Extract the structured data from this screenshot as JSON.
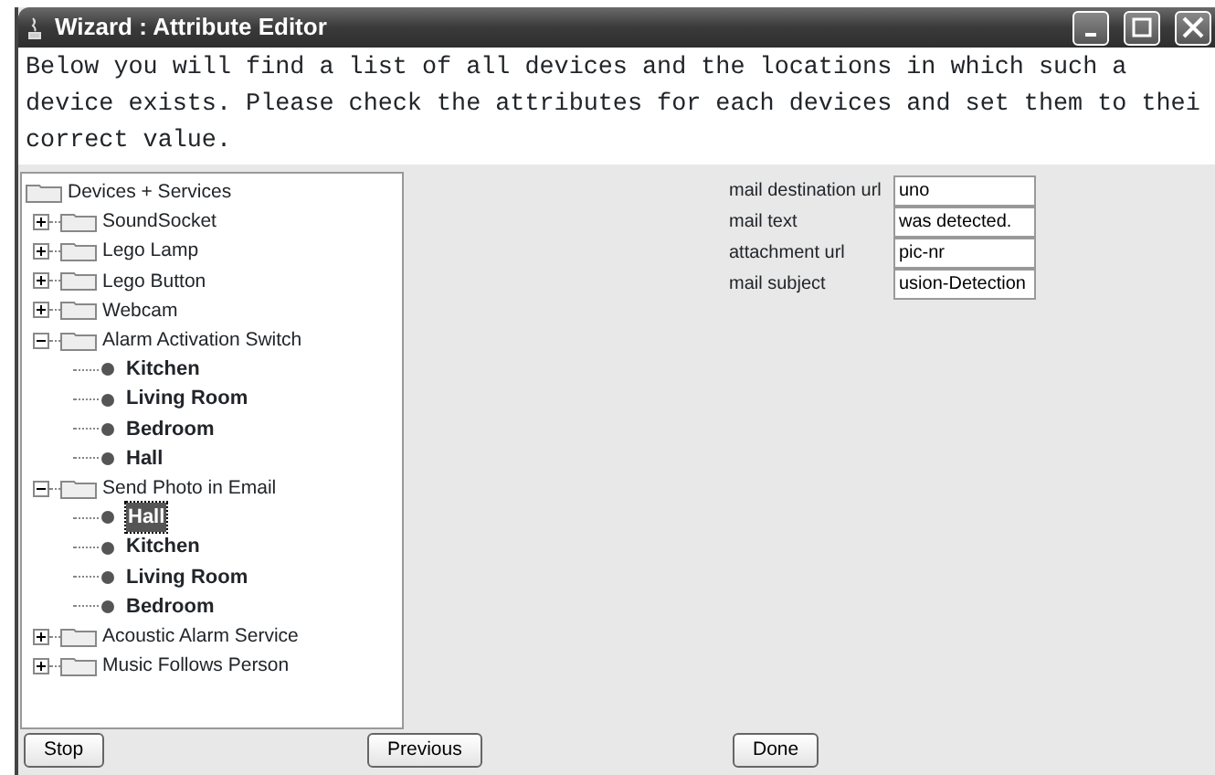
{
  "window": {
    "title": "Wizard : Attribute Editor"
  },
  "description": [
    "Below you will find a list of all devices and the locations in which such a",
    "device exists. Please check the attributes for each devices and set them to thei",
    "correct value."
  ],
  "tree": {
    "label": "Devices + Services",
    "children": [
      {
        "label": "SoundSocket",
        "expanded": false
      },
      {
        "label": "Lego Lamp",
        "expanded": false
      },
      {
        "label": "Lego Button",
        "expanded": false
      },
      {
        "label": "Webcam",
        "expanded": false
      },
      {
        "label": "Alarm Activation Switch",
        "expanded": true,
        "children": [
          {
            "label": "Kitchen",
            "selected": false
          },
          {
            "label": "Living Room",
            "selected": false
          },
          {
            "label": "Bedroom",
            "selected": false
          },
          {
            "label": "Hall",
            "selected": false
          }
        ]
      },
      {
        "label": "Send Photo in Email",
        "expanded": true,
        "children": [
          {
            "label": "Hall",
            "selected": true
          },
          {
            "label": "Kitchen",
            "selected": false
          },
          {
            "label": "Living Room",
            "selected": false
          },
          {
            "label": "Bedroom",
            "selected": false
          }
        ]
      },
      {
        "label": "Acoustic Alarm Service",
        "expanded": false
      },
      {
        "label": "Music Follows Person",
        "expanded": false
      }
    ]
  },
  "attributes": [
    {
      "label": "mail destination url",
      "value": "uno"
    },
    {
      "label": "mail text",
      "value": "was detected."
    },
    {
      "label": "attachment url",
      "value": "pic-nr"
    },
    {
      "label": "mail subject",
      "value": "usion-Detection"
    }
  ],
  "buttons": [
    "Stop",
    "Previous",
    "Done"
  ]
}
